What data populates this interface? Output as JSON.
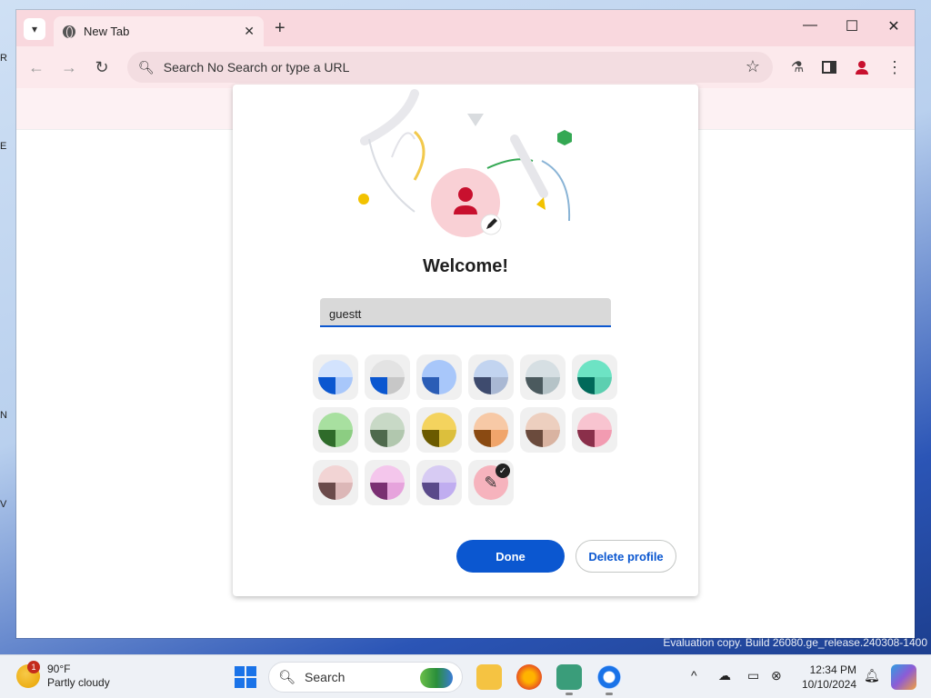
{
  "desktop": {
    "edge_glyphs": [
      "R",
      "E",
      "N",
      "V"
    ],
    "watermark": "Evaluation copy. Build 26080.ge_release.240308-1400"
  },
  "browser": {
    "tab": {
      "title": "New Tab",
      "close": "✕"
    },
    "new_tab": "+",
    "window_controls": {
      "minimize": "—",
      "maximize": "☐",
      "close": "✕"
    },
    "toolbar": {
      "back": "←",
      "forward": "→",
      "reload": "↻",
      "omnibox_text": "Search No Search or type a URL",
      "star": "☆"
    }
  },
  "dialog": {
    "title": "Welcome!",
    "name_value": "guestt",
    "swatches": [
      {
        "top": "#d3e3fd",
        "left": "#0b57d0",
        "right": "#a8c7fa"
      },
      {
        "top": "#e3e3e3",
        "left": "#0b57d0",
        "right": "#c7c7c7"
      },
      {
        "top": "#a8c7fa",
        "left": "#2b5db6",
        "right": "#a8c7fa"
      },
      {
        "top": "#c2d4f0",
        "left": "#3e4b6e",
        "right": "#a9b8d3"
      },
      {
        "top": "#d6dfe3",
        "left": "#4b5a5e",
        "right": "#b5c3c7"
      },
      {
        "top": "#6de3c4",
        "left": "#00695a",
        "right": "#5ccfb0"
      },
      {
        "top": "#a8e0a0",
        "left": "#2f6b2a",
        "right": "#8ccd82"
      },
      {
        "top": "#c8d9c6",
        "left": "#4f6a4d",
        "right": "#b1c7ae"
      },
      {
        "top": "#f4d35e",
        "left": "#6b5a00",
        "right": "#dcbf3c"
      },
      {
        "top": "#f7c9a6",
        "left": "#8a4a12",
        "right": "#f0a56b"
      },
      {
        "top": "#edcfbf",
        "left": "#6b4b3d",
        "right": "#d9b3a1"
      },
      {
        "top": "#f8c4d0",
        "left": "#8a2f4a",
        "right": "#f29bb1"
      },
      {
        "top": "#f2d4d4",
        "left": "#6b4a4a",
        "right": "#dcb7b7"
      },
      {
        "top": "#f4c6ec",
        "left": "#7a2f72",
        "right": "#e6a3dc"
      },
      {
        "top": "#d7cbf3",
        "left": "#5a4a8a",
        "right": "#c0adf0"
      }
    ],
    "custom_swatch_icon": "eyedropper-icon",
    "done": "Done",
    "delete": "Delete profile"
  },
  "taskbar": {
    "weather": {
      "badge": "1",
      "temp": "90°F",
      "condition": "Partly cloudy"
    },
    "search_placeholder": "Search",
    "tray_chevron": "^",
    "time": "12:34 PM",
    "date": "10/10/2024"
  }
}
